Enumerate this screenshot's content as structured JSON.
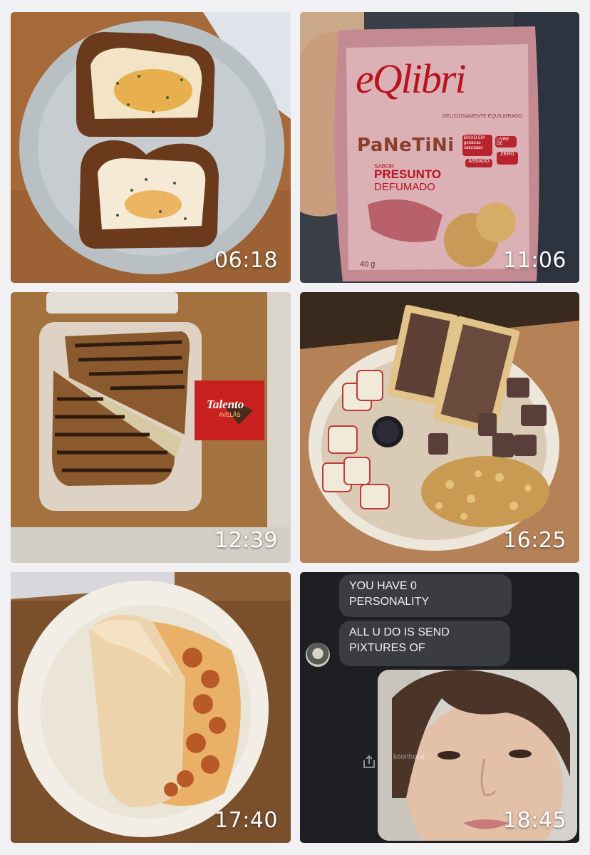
{
  "gallery": {
    "tiles": [
      {
        "time": "06:18",
        "image": "toast-with-eggs"
      },
      {
        "time": "11:06",
        "image": "eqlibri-panetini-bag",
        "package": {
          "brand": "eQlibri",
          "tagline": "DELICIOSAMENTE EQUILIBRADO",
          "product": "PaNeTiNi",
          "flavor_prefix": "SABOR",
          "flavor_line1": "PRESUNTO",
          "flavor_line2": "DEFUMADO",
          "badge1": "BAIXO EM gorduras saturadas",
          "badge2": "LIVRE DE",
          "badge3": "ASSADO",
          "badge4": "ZERO",
          "weight": "40 g"
        }
      },
      {
        "time": "12:39",
        "image": "grilled-sandwich-container",
        "chocolate": {
          "brand": "Talento",
          "flavor": "AVELÃS"
        }
      },
      {
        "time": "16:25",
        "image": "fruit-granola-bowl"
      },
      {
        "time": "17:40",
        "image": "crepe-with-shrimp"
      },
      {
        "time": "18:45",
        "image": "chat-screenshot",
        "chat": {
          "message1_line1": "YOU HAVE 0",
          "message1_line2": "PERSONALITY",
          "message2_line1": "ALL U DO IS SEND",
          "message2_line2": "PIXTURES OF",
          "watermark": "keonhoed"
        }
      }
    ]
  },
  "colors": {
    "page_background": "#f1f1f3",
    "timestamp_text": "#ffffff",
    "chat_bubble": "#3b3c41",
    "chat_background": "#1e1f23"
  }
}
